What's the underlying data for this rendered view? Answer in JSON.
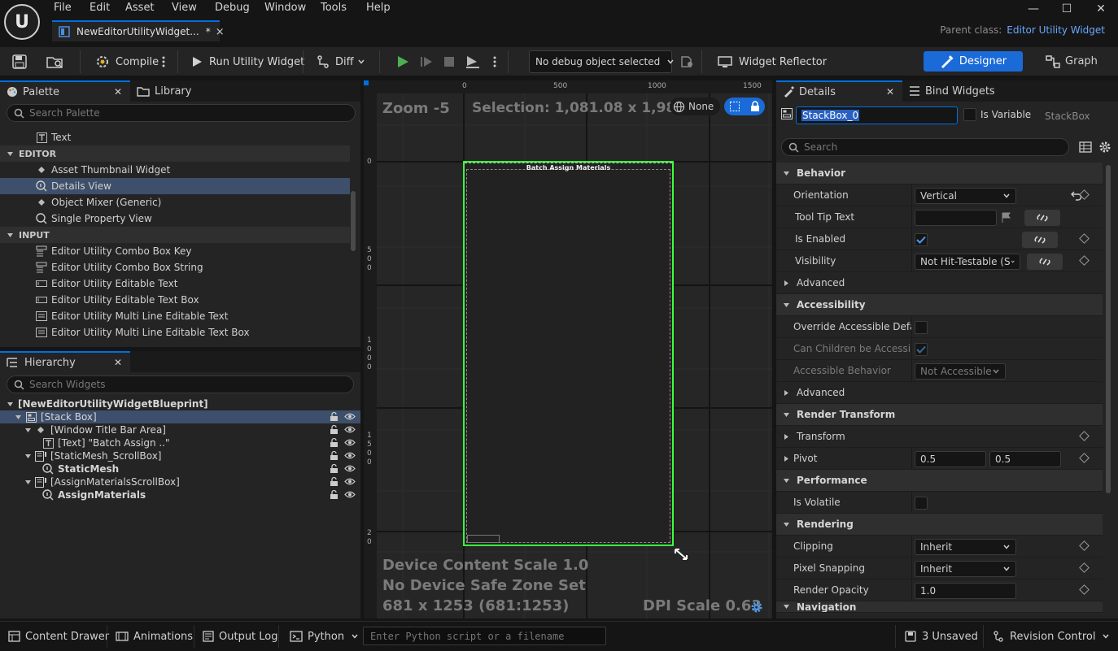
{
  "menu": [
    "File",
    "Edit",
    "Asset",
    "View",
    "Debug",
    "Window",
    "Tools",
    "Help"
  ],
  "document_tab": {
    "title": "NewEditorUtilityWidget...",
    "dirty": "*",
    "close": "×"
  },
  "parent_class": {
    "label": "Parent class:",
    "value": "Editor Utility Widget"
  },
  "toolbar": {
    "compile": "Compile",
    "run": "Run Utility Widget",
    "diff": "Diff",
    "debug_object": "No debug object selected",
    "widget_reflector": "Widget Reflector",
    "designer": "Designer",
    "graph": "Graph"
  },
  "palette": {
    "tabs": [
      "Palette",
      "Library"
    ],
    "search_placeholder": "Search Palette",
    "items_top": [
      "Text"
    ],
    "editor_category": "EDITOR",
    "editor_items": [
      "Asset Thumbnail Widget",
      "Details View",
      "Object Mixer (Generic)",
      "Single Property View"
    ],
    "input_category": "INPUT",
    "input_items": [
      "Editor Utility Combo Box Key",
      "Editor Utility Combo Box String",
      "Editor Utility Editable Text",
      "Editor Utility Editable Text Box",
      "Editor Utility Multi Line Editable Text",
      "Editor Utility Multi Line Editable Text Box"
    ]
  },
  "hierarchy": {
    "tab": "Hierarchy",
    "search_placeholder": "Search Widgets",
    "root": "[NewEditorUtilityWidgetBlueprint]",
    "rows": [
      "[Stack Box]",
      "[Window Title Bar Area]",
      "[Text] \"Batch Assign ..\"",
      "[StaticMesh_ScrollBox]",
      "StaticMesh",
      "[AssignMaterialsScrollBox]",
      "AssignMaterials"
    ]
  },
  "canvas": {
    "zoom": "Zoom -5",
    "selection": "Selection: 1,081.08 x 1,989.13",
    "none_label": "None",
    "ruler_top": [
      "0",
      "500",
      "1000",
      "1500"
    ],
    "ruler_left": [
      "0",
      "5\n0\n0",
      "1\n0\n0\n0",
      "1\n5\n0\n0",
      "2\n0"
    ],
    "widget_title": "Batch Assign Materials",
    "device_content_scale": "Device Content Scale 1.0",
    "safe_zone": "No Device Safe Zone Set",
    "resolution": "681 x 1253 (681:1253)",
    "dpi": "DPI Scale 0.63"
  },
  "details": {
    "tabs": [
      "Details",
      "Bind Widgets"
    ],
    "name": "StackBox_0",
    "is_variable": "Is Variable",
    "type": "StackBox",
    "search_placeholder": "Search",
    "behavior": "Behavior",
    "orientation": {
      "label": "Orientation",
      "value": "Vertical"
    },
    "tooltip": {
      "label": "Tool Tip Text",
      "value": ""
    },
    "is_enabled": {
      "label": "Is Enabled"
    },
    "visibility": {
      "label": "Visibility",
      "value": "Not Hit-Testable (S"
    },
    "advanced": "Advanced",
    "accessibility": "Accessibility",
    "override_accessible": "Override Accessible Defa...",
    "can_children": "Can Children be Accessible",
    "accessible_behavior": {
      "label": "Accessible Behavior",
      "value": "Not Accessible"
    },
    "render_transform": "Render Transform",
    "transform": "Transform",
    "pivot": {
      "label": "Pivot",
      "x": "0.5",
      "y": "0.5"
    },
    "performance": "Performance",
    "is_volatile": "Is Volatile",
    "rendering": "Rendering",
    "clipping": {
      "label": "Clipping",
      "value": "Inherit"
    },
    "pixel_snapping": {
      "label": "Pixel Snapping",
      "value": "Inherit"
    },
    "render_opacity": {
      "label": "Render Opacity",
      "value": "1.0"
    },
    "navigation": "Navigation"
  },
  "statusbar": {
    "content_drawer": "Content Drawer",
    "animations": "Animations",
    "output_log": "Output Log",
    "python": "Python",
    "console_placeholder": "Enter Python script or a filename",
    "unsaved": "3 Unsaved",
    "revision_control": "Revision Control"
  },
  "colors": {
    "accent": "#0070e0",
    "designer_button": "#1a6ad8",
    "selection_outline": "#3cff3c",
    "play": "#4caf50"
  }
}
